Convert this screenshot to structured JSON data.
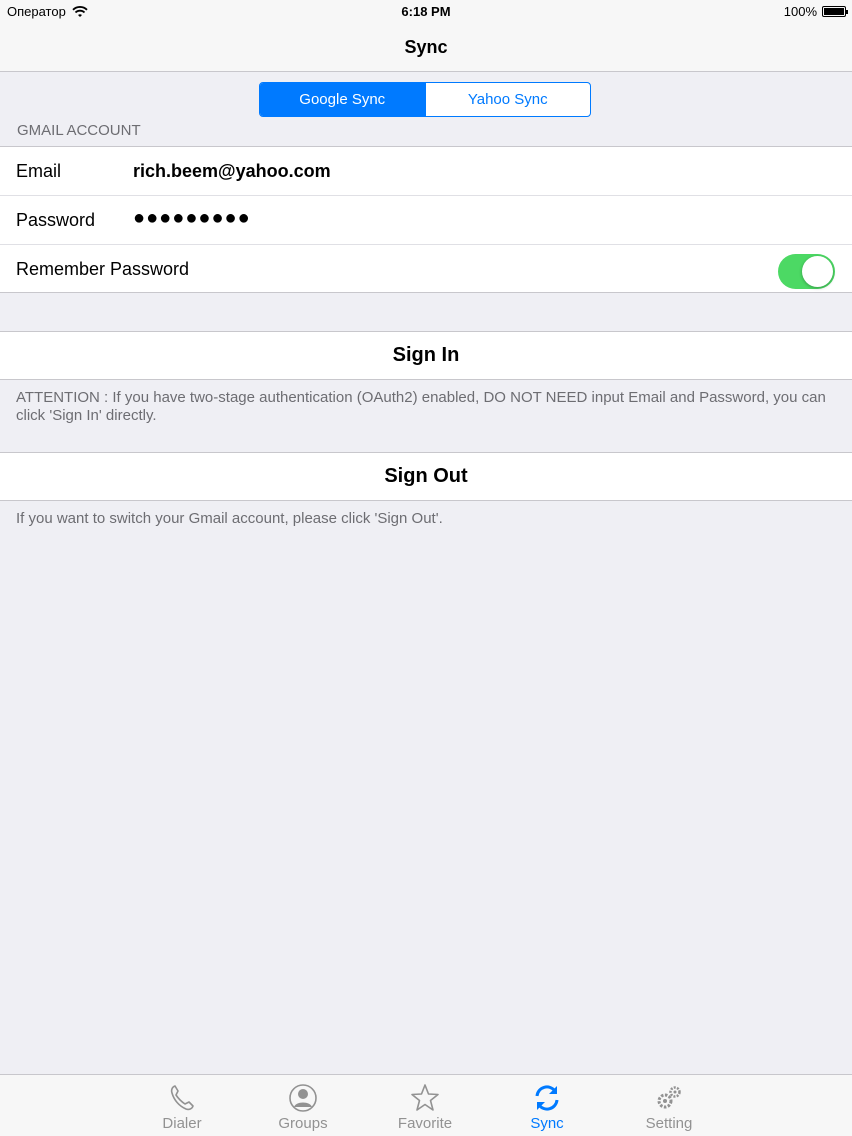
{
  "status_bar": {
    "carrier": "Оператор",
    "time": "6:18 PM",
    "battery_percent": "100%",
    "battery_level": 1.0
  },
  "nav": {
    "title": "Sync"
  },
  "segmented": {
    "options": [
      "Google Sync",
      "Yahoo Sync"
    ],
    "selected_index": 0
  },
  "account_section": {
    "header": "GMAIL ACCOUNT",
    "email_label": "Email",
    "email_value": "rich.beem@yahoo.com",
    "password_label": "Password",
    "password_value": "●●●●●●●●●",
    "remember_label": "Remember Password",
    "remember_on": true
  },
  "sign_in": {
    "label": "Sign In",
    "note": "ATTENTION : If you have two-stage authentication (OAuth2) enabled, DO NOT NEED input Email and Password, you can click 'Sign In' directly."
  },
  "sign_out": {
    "label": "Sign Out",
    "note": "If you want to switch your Gmail account, please click 'Sign Out'."
  },
  "tabs": [
    {
      "label": "Dialer",
      "icon": "phone-icon",
      "active": false
    },
    {
      "label": "Groups",
      "icon": "person-icon",
      "active": false
    },
    {
      "label": "Favorite",
      "icon": "star-icon",
      "active": false
    },
    {
      "label": "Sync",
      "icon": "sync-icon",
      "active": true
    },
    {
      "label": "Setting",
      "icon": "gears-icon",
      "active": false
    }
  ],
  "colors": {
    "accent": "#007aff",
    "toggle_on": "#4cd964",
    "background": "#efeff4",
    "inactive_tab": "#929292"
  }
}
